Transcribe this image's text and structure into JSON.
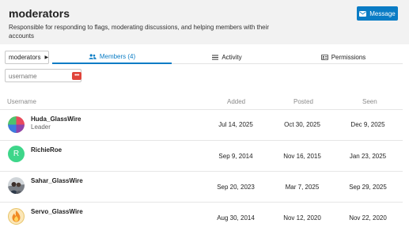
{
  "header": {
    "title": "moderators",
    "description": "Responsible for responding to flags, moderating discussions, and helping members with their accounts",
    "message_label": "Message"
  },
  "nav": {
    "group_select": "moderators",
    "tabs": [
      {
        "label": "Members (4)",
        "icon": "users-icon",
        "active": true
      },
      {
        "label": "Activity",
        "icon": "list-icon",
        "active": false
      },
      {
        "label": "Permissions",
        "icon": "id-card-icon",
        "active": false
      }
    ]
  },
  "filter": {
    "placeholder": "username",
    "icon": "ellipsis-icon"
  },
  "table": {
    "headers": {
      "username": "Username",
      "added": "Added",
      "posted": "Posted",
      "seen": "Seen"
    },
    "rows": [
      {
        "username": "Huda_GlassWire",
        "title": "Leader",
        "added": "Jul 14, 2025",
        "posted": "Oct 30, 2025",
        "seen": "Dec 9, 2025"
      },
      {
        "username": "RichieRoe",
        "title": "",
        "avatar_letter": "R",
        "added": "Sep 9, 2014",
        "posted": "Nov 16, 2015",
        "seen": "Jan 23, 2025"
      },
      {
        "username": "Sahar_GlassWire",
        "title": "",
        "added": "Sep 20, 2023",
        "posted": "Mar 7, 2025",
        "seen": "Sep 29, 2025"
      },
      {
        "username": "Servo_GlassWire",
        "title": "",
        "added": "Aug 30, 2014",
        "posted": "Nov 12, 2020",
        "seen": "Nov 22, 2020"
      }
    ]
  },
  "colors": {
    "accent": "#0a7cc5",
    "header_bg": "#f2f2f2",
    "avatar_green": "#3ed68a",
    "filter_icon": "#e0443a"
  }
}
